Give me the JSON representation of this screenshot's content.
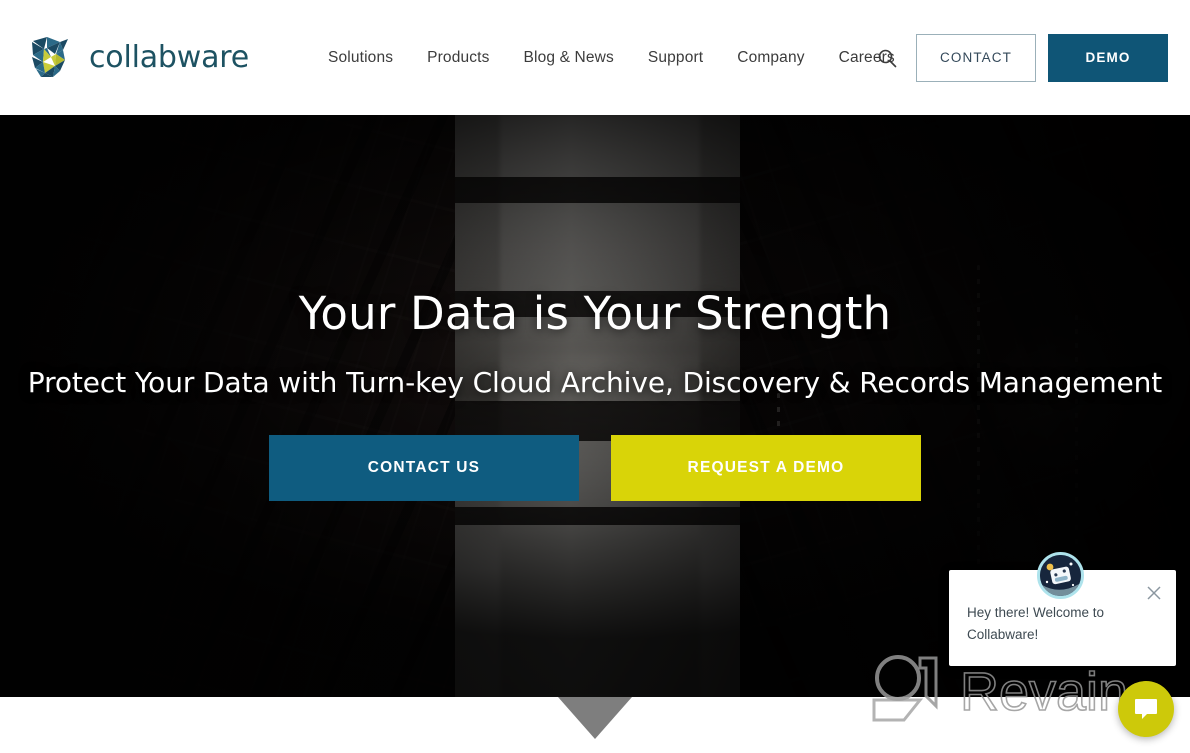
{
  "brand": {
    "name": "collabware",
    "logo_icon": "collabware-mosaic-logo",
    "colors": {
      "navy": "#1d5262",
      "deep_blue": "#0f5576",
      "hero_blue": "#0f5c80",
      "yellow": "#d9d408",
      "launcher_yellow": "#cdc90a",
      "text_dark": "#3c3c3c"
    }
  },
  "header": {
    "nav_items": [
      {
        "label": "Solutions"
      },
      {
        "label": "Products"
      },
      {
        "label": "Blog & News"
      },
      {
        "label": "Support"
      },
      {
        "label": "Company"
      },
      {
        "label": "Careers"
      }
    ],
    "search_icon": "search-icon",
    "contact_label": "CONTACT",
    "demo_label": "DEMO"
  },
  "hero": {
    "title": "Your Data is Your Strength",
    "subtitle": "Protect Your Data with Turn-key Cloud Archive, Discovery & Records Management",
    "primary_button": "CONTACT US",
    "secondary_button": "REQUEST A DEMO",
    "scroll_indicator_icon": "chevron-down-triangle-icon"
  },
  "chat": {
    "message": "Hey there! Welcome to Collabware!",
    "close_icon": "close-icon",
    "avatar_icon": "robot-avatar-icon",
    "launcher_icon": "chat-bubble-icon"
  },
  "watermark": {
    "text": "Revain",
    "mark_icon": "revain-logo-icon"
  }
}
